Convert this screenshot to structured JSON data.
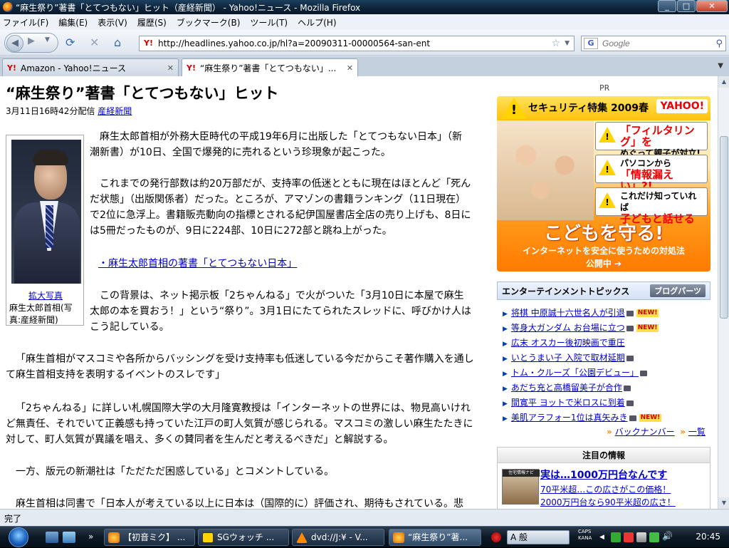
{
  "window": {
    "title": "“麻生祭り”著書「とてつもない」ヒット（産経新聞） - Yahoo!ニュース - Mozilla Firefox"
  },
  "menu": [
    "ファイル(F)",
    "編集(E)",
    "表示(V)",
    "履歴(S)",
    "ブックマーク(B)",
    "ツール(T)",
    "ヘルプ(H)"
  ],
  "navbar": {
    "url": "http://headlines.yahoo.co.jp/hl?a=20090311-00000564-san-ent",
    "search_placeholder": "Google"
  },
  "tabs": [
    {
      "label": "Amazon - Yahoo!ニュース"
    },
    {
      "label": "“麻生祭り”著書「とてつもない」..."
    }
  ],
  "article": {
    "headline": "“麻生祭り”著書「とてつもない」ヒット",
    "date": "3月11日16時42分配信",
    "source": "産経新聞",
    "photo_link": "拡大写真",
    "photo_caption": "麻生太郎首相(写真:産経新聞)",
    "p1": "麻生太郎首相が外務大臣時代の平成19年6月に出版した「とてつもない日本」（新潮新書）が10日、全国で爆発的に売れるという珍現象が起こった。",
    "p2": "これまでの発行部数は約20万部だが、支持率の低迷とともに現在はほとんど「死んだ状態」（出版関係者）だった。ところが、アマゾンの書籍ランキング（11日現在）で2位に急浮上。書籍販売動向の指標とされる紀伊国屋書店全店の売り上げも、8日には5冊だったものが、9日に224部、10日に272部と跳ね上がった。",
    "link": "・麻生太郎首相の著書「とてつもない日本」",
    "p3": "この背景は、ネット掲示板「2ちゃんねる」で火がついた「3月10日に本屋で麻生太郎の本を買おう！」という“祭り”。3月1日にたてられたスレッドに、呼びかけ人はこう記している。",
    "p4": "「麻生首相がマスコミや各所からバッシングを受け支持率も低迷している今だからこそ著作購入を通して麻生首相支持を表明するイベントのスレです」",
    "p5": "「2ちゃんねる」に詳しい札幌国際大学の大月隆寛教授は「インターネットの世界には、物見高いけれど無責任、それでいて正義感も持っていた江戸の町人気質が感じられる。マスコミの激しい麻生たたきに対して、町人気質が異議を唱え、多くの賛同者を生んだと考えるべきだ」と解説する。",
    "p6": "一方、版元の新潮社は「ただただ困惑している」とコメントしている。",
    "p7": "麻生首相は同書で「日本人が考えている以上に日本は（国際的に）評価され、期待もされている。悲"
  },
  "sidebar": {
    "pr": "PR",
    "ad": {
      "title": "セキュリティ特集 2009春",
      "logo": "YAHOO!",
      "box1_a": "「フィルタリング」を",
      "box1_b": "めぐって親子が対立!",
      "box2_a": "パソコンから",
      "box2_b": "「情報漏えい」?!",
      "box3_a": "これだけ知っていれば",
      "box3_b": "子どもと話せる",
      "big": "こどもを守る!",
      "sub": "インターネットを安全に使うための対処法",
      "cta": "公開中 ➔"
    },
    "topics_title": "エンターテインメントトピックス",
    "blog_parts": "ブログパーツ",
    "topics": [
      {
        "text": "将棋 中原誠十六世名人が引退",
        "new": "NEW!"
      },
      {
        "text": "等身大ガンダム お台場に立つ",
        "new": "NEW!"
      },
      {
        "text": "広末 オスカー後初映画で重圧",
        "new": ""
      },
      {
        "text": "いとうまい子 入院で取材延期",
        "new": ""
      },
      {
        "text": "トム・クルーズ「公園デビュー」",
        "new": ""
      },
      {
        "text": "あだち充と高橋留美子が合作",
        "new": ""
      },
      {
        "text": "間寛平 ヨットで米ロスに到着",
        "new": ""
      },
      {
        "text": "美肌アラフォー1位は真矢みき",
        "new": "NEW!"
      }
    ],
    "backnumber": "バックナンバー",
    "list": "一覧",
    "attention": {
      "title": "注目の情報",
      "thumb_label": "住宅情報ナビ",
      "big": "実は…1000万円台なんです",
      "line1": "70平米超…この広さがこの価格！",
      "line2": "2000万円台なら90平米超の広さ！"
    }
  },
  "status": "完了",
  "taskbar": {
    "items": [
      {
        "label": "【初音ミク】 ..."
      },
      {
        "label": "SGウォッチ ..."
      },
      {
        "label": "dvd://J:¥ - V..."
      },
      {
        "label": "“麻生祭り”著..."
      }
    ],
    "ime": "A 般",
    "caps": "CAPS",
    "kana": "KANA",
    "clock": "20:45"
  }
}
